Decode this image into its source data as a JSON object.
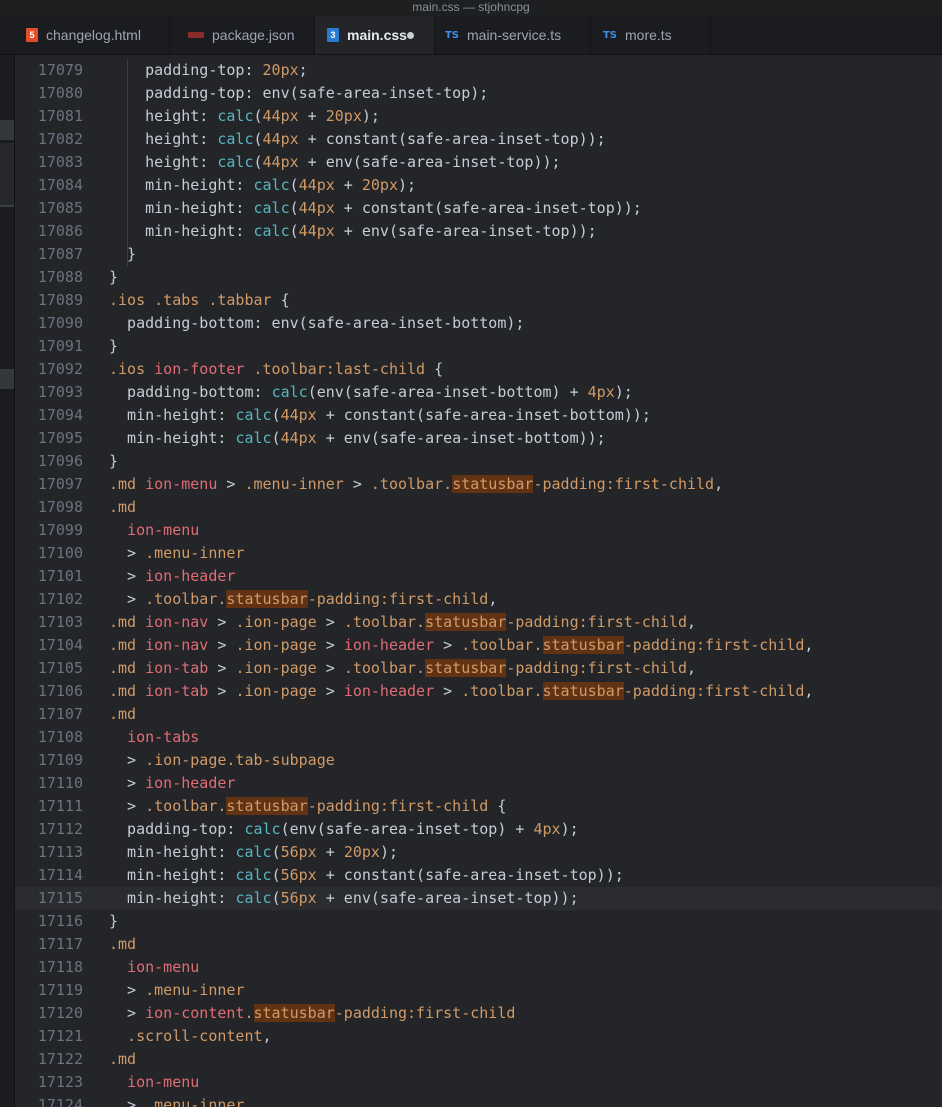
{
  "window_title": "main.css — stjohncpg",
  "tabs": [
    {
      "label": "changelog.html",
      "icon": "html5-icon",
      "icon_text": "5",
      "active": false
    },
    {
      "label": "package.json",
      "icon": "npm-icon",
      "icon_text": "",
      "active": false
    },
    {
      "label": "main.css",
      "icon": "css3-icon",
      "icon_text": "3",
      "active": true,
      "modified": true
    },
    {
      "label": "main-service.ts",
      "icon": "typescript-icon",
      "icon_text": "TS",
      "active": false
    },
    {
      "label": "more.ts",
      "icon": "typescript-icon",
      "icon_text": "TS",
      "active": false
    }
  ],
  "colors": {
    "selector": "#d19a66",
    "tag": "#e06c75",
    "function": "#56b6c2",
    "number": "#d19a66",
    "text": "#c6ccd7",
    "search_highlight": "#613214",
    "background": "#232528"
  },
  "editor": {
    "current_line": 17115,
    "highlight_term": "statusbar",
    "lines": [
      {
        "n": "17079",
        "tokens": [
          [
            "p",
            "    padding-top: "
          ],
          [
            "n",
            "20px"
          ],
          [
            "p",
            ";"
          ]
        ]
      },
      {
        "n": "17080",
        "tokens": [
          [
            "p",
            "    padding-top: env(safe-area-inset-top);"
          ]
        ]
      },
      {
        "n": "17081",
        "tokens": [
          [
            "p",
            "    height: "
          ],
          [
            "f",
            "calc"
          ],
          [
            "p",
            "("
          ],
          [
            "n",
            "44px"
          ],
          [
            "p",
            " + "
          ],
          [
            "n",
            "20px"
          ],
          [
            "p",
            ");"
          ]
        ]
      },
      {
        "n": "17082",
        "tokens": [
          [
            "p",
            "    height: "
          ],
          [
            "f",
            "calc"
          ],
          [
            "p",
            "("
          ],
          [
            "n",
            "44px"
          ],
          [
            "p",
            " + constant(safe-area-inset-top));"
          ]
        ]
      },
      {
        "n": "17083",
        "tokens": [
          [
            "p",
            "    height: "
          ],
          [
            "f",
            "calc"
          ],
          [
            "p",
            "("
          ],
          [
            "n",
            "44px"
          ],
          [
            "p",
            " + env(safe-area-inset-top));"
          ]
        ]
      },
      {
        "n": "17084",
        "tokens": [
          [
            "p",
            "    min-height: "
          ],
          [
            "f",
            "calc"
          ],
          [
            "p",
            "("
          ],
          [
            "n",
            "44px"
          ],
          [
            "p",
            " + "
          ],
          [
            "n",
            "20px"
          ],
          [
            "p",
            ");"
          ]
        ]
      },
      {
        "n": "17085",
        "tokens": [
          [
            "p",
            "    min-height: "
          ],
          [
            "f",
            "calc"
          ],
          [
            "p",
            "("
          ],
          [
            "n",
            "44px"
          ],
          [
            "p",
            " + constant(safe-area-inset-top));"
          ]
        ]
      },
      {
        "n": "17086",
        "tokens": [
          [
            "p",
            "    min-height: "
          ],
          [
            "f",
            "calc"
          ],
          [
            "p",
            "("
          ],
          [
            "n",
            "44px"
          ],
          [
            "p",
            " + env(safe-area-inset-top));"
          ]
        ]
      },
      {
        "n": "17087",
        "tokens": [
          [
            "p",
            "  }"
          ]
        ]
      },
      {
        "n": "17088",
        "tokens": [
          [
            "p",
            "}"
          ]
        ]
      },
      {
        "n": "17089",
        "tokens": [
          [
            "s",
            ".ios .tabs .tabbar"
          ],
          [
            "p",
            " {"
          ]
        ]
      },
      {
        "n": "17090",
        "tokens": [
          [
            "p",
            "  padding-bottom: env(safe-area-inset-bottom);"
          ]
        ]
      },
      {
        "n": "17091",
        "tokens": [
          [
            "p",
            "}"
          ]
        ]
      },
      {
        "n": "17092",
        "tokens": [
          [
            "s",
            ".ios "
          ],
          [
            "t",
            "ion-footer"
          ],
          [
            "s",
            " .toolbar:last-child"
          ],
          [
            "p",
            " {"
          ]
        ]
      },
      {
        "n": "17093",
        "tokens": [
          [
            "p",
            "  padding-bottom: "
          ],
          [
            "f",
            "calc"
          ],
          [
            "p",
            "(env(safe-area-inset-bottom) + "
          ],
          [
            "n",
            "4px"
          ],
          [
            "p",
            ");"
          ]
        ]
      },
      {
        "n": "17094",
        "tokens": [
          [
            "p",
            "  min-height: "
          ],
          [
            "f",
            "calc"
          ],
          [
            "p",
            "("
          ],
          [
            "n",
            "44px"
          ],
          [
            "p",
            " + constant(safe-area-inset-bottom));"
          ]
        ]
      },
      {
        "n": "17095",
        "tokens": [
          [
            "p",
            "  min-height: "
          ],
          [
            "f",
            "calc"
          ],
          [
            "p",
            "("
          ],
          [
            "n",
            "44px"
          ],
          [
            "p",
            " + env(safe-area-inset-bottom));"
          ]
        ]
      },
      {
        "n": "17096",
        "tokens": [
          [
            "p",
            "}"
          ]
        ]
      },
      {
        "n": "17097",
        "tokens": [
          [
            "s",
            ".md "
          ],
          [
            "t",
            "ion-menu"
          ],
          [
            "w",
            " > "
          ],
          [
            "s",
            ".menu-inner"
          ],
          [
            "w",
            " > "
          ],
          [
            "s",
            ".toolbar."
          ],
          [
            "h",
            "statusbar"
          ],
          [
            "s",
            "-padding:first-child"
          ],
          [
            "p",
            ","
          ]
        ]
      },
      {
        "n": "17098",
        "tokens": [
          [
            "s",
            ".md"
          ]
        ]
      },
      {
        "n": "17099",
        "tokens": [
          [
            "p",
            "  "
          ],
          [
            "t",
            "ion-menu"
          ]
        ]
      },
      {
        "n": "17100",
        "tokens": [
          [
            "w",
            "  > "
          ],
          [
            "s",
            ".menu-inner"
          ]
        ]
      },
      {
        "n": "17101",
        "tokens": [
          [
            "w",
            "  > "
          ],
          [
            "t",
            "ion-header"
          ]
        ]
      },
      {
        "n": "17102",
        "tokens": [
          [
            "w",
            "  > "
          ],
          [
            "s",
            ".toolbar."
          ],
          [
            "h",
            "statusbar"
          ],
          [
            "s",
            "-padding:first-child"
          ],
          [
            "p",
            ","
          ]
        ]
      },
      {
        "n": "17103",
        "tokens": [
          [
            "s",
            ".md "
          ],
          [
            "t",
            "ion-nav"
          ],
          [
            "w",
            " > "
          ],
          [
            "s",
            ".ion-page"
          ],
          [
            "w",
            " > "
          ],
          [
            "s",
            ".toolbar."
          ],
          [
            "h",
            "statusbar"
          ],
          [
            "s",
            "-padding:first-child"
          ],
          [
            "p",
            ","
          ]
        ]
      },
      {
        "n": "17104",
        "tokens": [
          [
            "s",
            ".md "
          ],
          [
            "t",
            "ion-nav"
          ],
          [
            "w",
            " > "
          ],
          [
            "s",
            ".ion-page"
          ],
          [
            "w",
            " > "
          ],
          [
            "t",
            "ion-header"
          ],
          [
            "w",
            " > "
          ],
          [
            "s",
            ".toolbar."
          ],
          [
            "h",
            "statusbar"
          ],
          [
            "s",
            "-padding:first-child"
          ],
          [
            "p",
            ","
          ]
        ]
      },
      {
        "n": "17105",
        "tokens": [
          [
            "s",
            ".md "
          ],
          [
            "t",
            "ion-tab"
          ],
          [
            "w",
            " > "
          ],
          [
            "s",
            ".ion-page"
          ],
          [
            "w",
            " > "
          ],
          [
            "s",
            ".toolbar."
          ],
          [
            "h",
            "statusbar"
          ],
          [
            "s",
            "-padding:first-child"
          ],
          [
            "p",
            ","
          ]
        ]
      },
      {
        "n": "17106",
        "tokens": [
          [
            "s",
            ".md "
          ],
          [
            "t",
            "ion-tab"
          ],
          [
            "w",
            " > "
          ],
          [
            "s",
            ".ion-page"
          ],
          [
            "w",
            " > "
          ],
          [
            "t",
            "ion-header"
          ],
          [
            "w",
            " > "
          ],
          [
            "s",
            ".toolbar."
          ],
          [
            "h",
            "statusbar"
          ],
          [
            "s",
            "-padding:first-child"
          ],
          [
            "p",
            ","
          ]
        ]
      },
      {
        "n": "17107",
        "tokens": [
          [
            "s",
            ".md"
          ]
        ]
      },
      {
        "n": "17108",
        "tokens": [
          [
            "p",
            "  "
          ],
          [
            "t",
            "ion-tabs"
          ]
        ]
      },
      {
        "n": "17109",
        "tokens": [
          [
            "w",
            "  > "
          ],
          [
            "s",
            ".ion-page.tab-subpage"
          ]
        ]
      },
      {
        "n": "17110",
        "tokens": [
          [
            "w",
            "  > "
          ],
          [
            "t",
            "ion-header"
          ]
        ]
      },
      {
        "n": "17111",
        "tokens": [
          [
            "w",
            "  > "
          ],
          [
            "s",
            ".toolbar."
          ],
          [
            "h",
            "statusbar"
          ],
          [
            "s",
            "-padding:first-child"
          ],
          [
            "p",
            " {"
          ]
        ]
      },
      {
        "n": "17112",
        "tokens": [
          [
            "p",
            "  padding-top: "
          ],
          [
            "f",
            "calc"
          ],
          [
            "p",
            "(env(safe-area-inset-top) + "
          ],
          [
            "n",
            "4px"
          ],
          [
            "p",
            ");"
          ]
        ]
      },
      {
        "n": "17113",
        "tokens": [
          [
            "p",
            "  min-height: "
          ],
          [
            "f",
            "calc"
          ],
          [
            "p",
            "("
          ],
          [
            "n",
            "56px"
          ],
          [
            "p",
            " + "
          ],
          [
            "n",
            "20px"
          ],
          [
            "p",
            ");"
          ]
        ]
      },
      {
        "n": "17114",
        "tokens": [
          [
            "p",
            "  min-height: "
          ],
          [
            "f",
            "calc"
          ],
          [
            "p",
            "("
          ],
          [
            "n",
            "56px"
          ],
          [
            "p",
            " + constant(safe-area-inset-top));"
          ]
        ]
      },
      {
        "n": "17115",
        "tokens": [
          [
            "p",
            "  min-height: "
          ],
          [
            "f",
            "calc"
          ],
          [
            "p",
            "("
          ],
          [
            "n",
            "56px"
          ],
          [
            "p",
            " + env(safe-area-inset-top));"
          ]
        ]
      },
      {
        "n": "17116",
        "tokens": [
          [
            "p",
            "}"
          ]
        ]
      },
      {
        "n": "17117",
        "tokens": [
          [
            "s",
            ".md"
          ]
        ]
      },
      {
        "n": "17118",
        "tokens": [
          [
            "p",
            "  "
          ],
          [
            "t",
            "ion-menu"
          ]
        ]
      },
      {
        "n": "17119",
        "tokens": [
          [
            "w",
            "  > "
          ],
          [
            "s",
            ".menu-inner"
          ]
        ]
      },
      {
        "n": "17120",
        "tokens": [
          [
            "w",
            "  > "
          ],
          [
            "t",
            "ion-content"
          ],
          [
            "s",
            "."
          ],
          [
            "h",
            "statusbar"
          ],
          [
            "s",
            "-padding:first-child"
          ]
        ]
      },
      {
        "n": "17121",
        "tokens": [
          [
            "p",
            "  "
          ],
          [
            "s",
            ".scroll-content"
          ],
          [
            "p",
            ","
          ]
        ]
      },
      {
        "n": "17122",
        "tokens": [
          [
            "s",
            ".md"
          ]
        ]
      },
      {
        "n": "17123",
        "tokens": [
          [
            "p",
            "  "
          ],
          [
            "t",
            "ion-menu"
          ]
        ]
      },
      {
        "n": "17124",
        "tokens": [
          [
            "w",
            "  > "
          ],
          [
            "s",
            ".menu-inner"
          ]
        ]
      }
    ]
  }
}
